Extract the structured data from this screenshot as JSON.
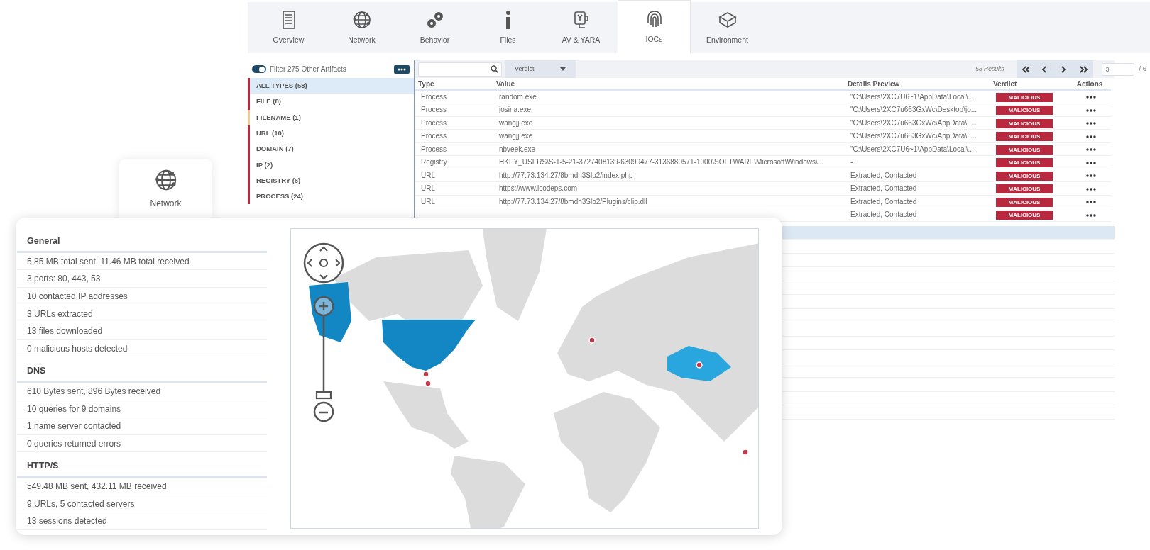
{
  "tabs": [
    {
      "label": "Overview",
      "selected": false
    },
    {
      "label": "Network",
      "selected": false
    },
    {
      "label": "Behavior",
      "selected": false
    },
    {
      "label": "Files",
      "selected": false
    },
    {
      "label": "AV & YARA",
      "selected": false
    },
    {
      "label": "IOCs",
      "selected": true
    },
    {
      "label": "Environment",
      "selected": false
    }
  ],
  "filter": {
    "on": true,
    "label": "Filter 275 Other Artifacts"
  },
  "artifact_types": [
    {
      "label": "ALL TYPES (58)",
      "color": "#b8293f",
      "selected": true
    },
    {
      "label": "FILE (8)",
      "color": "#b8293f",
      "selected": false
    },
    {
      "label": "FILENAME (1)",
      "color": "#f0c896",
      "selected": false
    },
    {
      "label": "URL (10)",
      "color": "#b8293f",
      "selected": false
    },
    {
      "label": "DOMAIN (7)",
      "color": "#b8293f",
      "selected": false
    },
    {
      "label": "IP (2)",
      "color": "#b8293f",
      "selected": false
    },
    {
      "label": "REGISTRY (6)",
      "color": "#b8293f",
      "selected": false
    },
    {
      "label": "PROCESS (24)",
      "color": "#b8293f",
      "selected": false
    }
  ],
  "table": {
    "verdict_filter": "Verdict",
    "results": "58 Results",
    "page": "3",
    "page_total": "/ 6",
    "columns": [
      "Type",
      "Value",
      "Details Preview",
      "Verdict",
      "Actions"
    ],
    "rows": [
      {
        "type": "Process",
        "value": "random.exe",
        "details": "\"C:\\Users\\2XC7U6~1\\AppData\\Local\\...",
        "verdict": "MALICIOUS"
      },
      {
        "type": "Process",
        "value": "josina.exe",
        "details": "\"C:\\Users\\2XC7u663GxWc\\Desktop\\jo...",
        "verdict": "MALICIOUS"
      },
      {
        "type": "Process",
        "value": "wangjj.exe",
        "details": "\"C:\\Users\\2XC7u663GxWc\\AppData\\L...",
        "verdict": "MALICIOUS"
      },
      {
        "type": "Process",
        "value": "wangjj.exe",
        "details": "\"C:\\Users\\2XC7u663GxWc\\AppData\\L...",
        "verdict": "MALICIOUS"
      },
      {
        "type": "Process",
        "value": "nbveek.exe",
        "details": "\"C:\\Users\\2XC7U6~1\\AppData\\Local\\...",
        "verdict": "MALICIOUS"
      },
      {
        "type": "Registry",
        "value": "HKEY_USERS\\S-1-5-21-3727408139-63090477-3136880571-1000\\SOFTWARE\\Microsoft\\Windows\\...",
        "details": "-",
        "verdict": "MALICIOUS"
      },
      {
        "type": "URL",
        "value": "http://77.73.134.27/8bmdh3Slb2/index.php",
        "details": "Extracted, Contacted",
        "verdict": "MALICIOUS"
      },
      {
        "type": "URL",
        "value": "https://www.icodeps.com",
        "details": "Extracted, Contacted",
        "verdict": "MALICIOUS"
      },
      {
        "type": "URL",
        "value": "http://77.73.134.27/8bmdh3Slb2/Plugins/clip.dll",
        "details": "Extracted, Contacted",
        "verdict": "MALICIOUS"
      },
      {
        "details": "Extracted, Contacted",
        "verdict": "MALICIOUS"
      }
    ]
  },
  "network_panel": {
    "tab_label": "Network",
    "sections": [
      {
        "title": "General",
        "items": [
          "5.85 MB total sent, 11.46 MB total received",
          "3 ports: 80, 443, 53",
          "10 contacted IP addresses",
          "3 URLs extracted",
          "13 files downloaded",
          "0 malicious hosts detected"
        ]
      },
      {
        "title": "DNS",
        "items": [
          "610 Bytes sent, 896 Bytes received",
          "10 queries for 9 domains",
          "1 name server contacted",
          "0 queries returned errors"
        ]
      },
      {
        "title": "HTTP/S",
        "items": [
          "549.48 MB sent, 432.11 MB received",
          "9 URLs, 5 contacted servers",
          "13 sessions detected"
        ]
      }
    ]
  },
  "map": {
    "zoom_slider": {
      "level": 0
    }
  }
}
